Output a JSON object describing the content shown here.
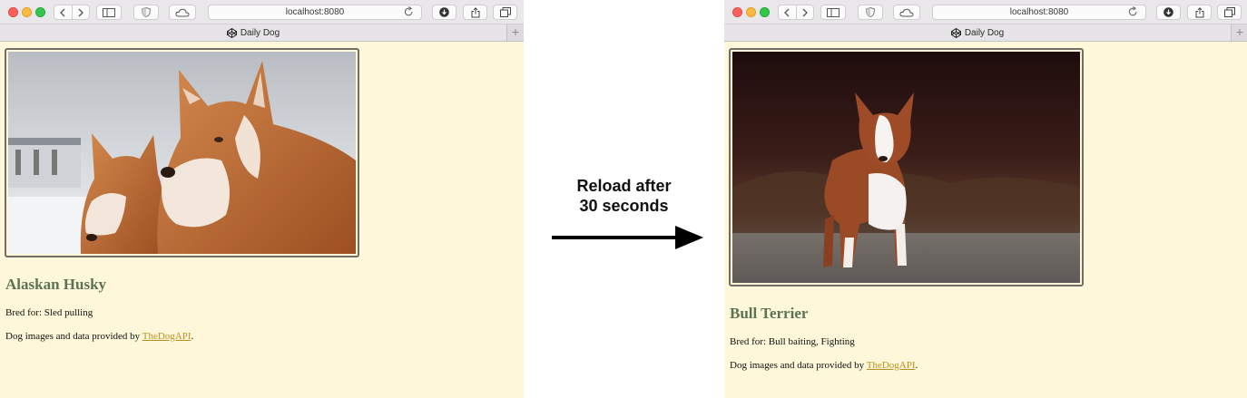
{
  "browser_left": {
    "address": "localhost:8080",
    "tab_title": "Daily Dog",
    "newtab_symbol": "+",
    "dog": {
      "breed": "Alaskan Husky",
      "bred_for": "Bred for: Sled pulling",
      "photo_subject": "Two Alaskan Huskies"
    },
    "credit_prefix": "Dog images and data provided by ",
    "credit_link": "TheDogAPI",
    "credit_suffix": "."
  },
  "browser_right": {
    "address": "localhost:8080",
    "tab_title": "Daily Dog",
    "newtab_symbol": "+",
    "dog": {
      "breed": "Bull Terrier",
      "bred_for": "Bred for: Bull baiting, Fighting",
      "photo_subject": "Bull Terrier"
    },
    "credit_prefix": "Dog images and data provided by ",
    "credit_link": "TheDogAPI",
    "credit_suffix": "."
  },
  "transition": {
    "line1": "Reload after",
    "line2": "30 seconds"
  },
  "colors": {
    "page_background": "#fef7d9",
    "heading": "#5b7356",
    "link": "#b8901f"
  }
}
